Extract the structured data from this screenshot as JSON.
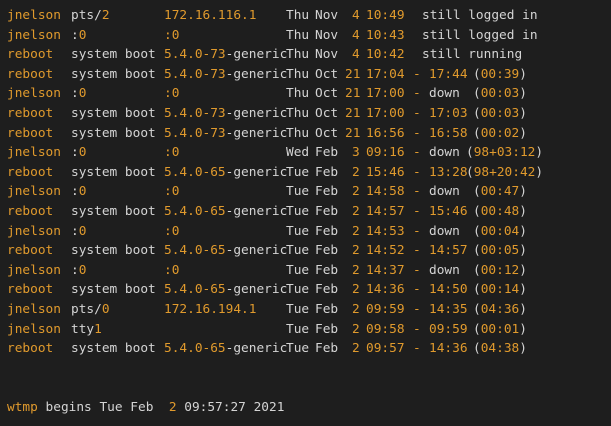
{
  "colors": {
    "background": "#1e1e1e",
    "text": "#d4d4d4",
    "accent": "#e09a2d"
  },
  "rows": [
    {
      "user": "jnelson",
      "tty": "pts/",
      "tty_num": "2",
      "host": "172.16.116.1",
      "day": "Thu",
      "mon": "Nov",
      "date": "4",
      "start": "10:49",
      "status": "still logged in",
      "end": "",
      "dur_open": "",
      "dur": "",
      "dur_close": ""
    },
    {
      "user": "jnelson",
      "tty": ":",
      "tty_num": "0",
      "host": ":0",
      "day": "Thu",
      "mon": "Nov",
      "date": "4",
      "start": "10:43",
      "status": "still logged in",
      "end": "",
      "dur_open": "",
      "dur": "",
      "dur_close": ""
    },
    {
      "user": "reboot",
      "tty": "system boot",
      "tty_num": "",
      "host": "5.4.0-73-generic",
      "day": "Thu",
      "mon": "Nov",
      "date": "4",
      "start": "10:42",
      "status": "still running",
      "end": "",
      "dur_open": "",
      "dur": "",
      "dur_close": ""
    },
    {
      "user": "reboot",
      "tty": "system boot",
      "tty_num": "",
      "host": "5.4.0-73-generic",
      "day": "Thu",
      "mon": "Oct",
      "date": "21",
      "start": "17:04",
      "status": "-",
      "end": "17:44",
      "dur_open": "(",
      "dur": "00:39",
      "dur_close": ")"
    },
    {
      "user": "jnelson",
      "tty": ":",
      "tty_num": "0",
      "host": ":0",
      "day": "Thu",
      "mon": "Oct",
      "date": "21",
      "start": "17:00",
      "status": "-",
      "end": "down",
      "dur_open": "(",
      "dur": "00:03",
      "dur_close": ")"
    },
    {
      "user": "reboot",
      "tty": "system boot",
      "tty_num": "",
      "host": "5.4.0-73-generic",
      "day": "Thu",
      "mon": "Oct",
      "date": "21",
      "start": "17:00",
      "status": "-",
      "end": "17:03",
      "dur_open": "(",
      "dur": "00:03",
      "dur_close": ")"
    },
    {
      "user": "reboot",
      "tty": "system boot",
      "tty_num": "",
      "host": "5.4.0-73-generic",
      "day": "Thu",
      "mon": "Oct",
      "date": "21",
      "start": "16:56",
      "status": "-",
      "end": "16:58",
      "dur_open": "(",
      "dur": "00:02",
      "dur_close": ")"
    },
    {
      "user": "jnelson",
      "tty": ":",
      "tty_num": "0",
      "host": ":0",
      "day": "Wed",
      "mon": "Feb",
      "date": "3",
      "start": "09:16",
      "status": "-",
      "end": "down",
      "dur_open": "(",
      "dur": "98+03:12",
      "dur_close": ")"
    },
    {
      "user": "reboot",
      "tty": "system boot",
      "tty_num": "",
      "host": "5.4.0-65-generic",
      "day": "Tue",
      "mon": "Feb",
      "date": "2",
      "start": "15:46",
      "status": "-",
      "end": "13:28",
      "dur_open": "(",
      "dur": "98+20:42",
      "dur_close": ")"
    },
    {
      "user": "jnelson",
      "tty": ":",
      "tty_num": "0",
      "host": ":0",
      "day": "Tue",
      "mon": "Feb",
      "date": "2",
      "start": "14:58",
      "status": "-",
      "end": "down",
      "dur_open": "(",
      "dur": "00:47",
      "dur_close": ")"
    },
    {
      "user": "reboot",
      "tty": "system boot",
      "tty_num": "",
      "host": "5.4.0-65-generic",
      "day": "Tue",
      "mon": "Feb",
      "date": "2",
      "start": "14:57",
      "status": "-",
      "end": "15:46",
      "dur_open": "(",
      "dur": "00:48",
      "dur_close": ")"
    },
    {
      "user": "jnelson",
      "tty": ":",
      "tty_num": "0",
      "host": ":0",
      "day": "Tue",
      "mon": "Feb",
      "date": "2",
      "start": "14:53",
      "status": "-",
      "end": "down",
      "dur_open": "(",
      "dur": "00:04",
      "dur_close": ")"
    },
    {
      "user": "reboot",
      "tty": "system boot",
      "tty_num": "",
      "host": "5.4.0-65-generic",
      "day": "Tue",
      "mon": "Feb",
      "date": "2",
      "start": "14:52",
      "status": "-",
      "end": "14:57",
      "dur_open": "(",
      "dur": "00:05",
      "dur_close": ")"
    },
    {
      "user": "jnelson",
      "tty": ":",
      "tty_num": "0",
      "host": ":0",
      "day": "Tue",
      "mon": "Feb",
      "date": "2",
      "start": "14:37",
      "status": "-",
      "end": "down",
      "dur_open": "(",
      "dur": "00:12",
      "dur_close": ")"
    },
    {
      "user": "reboot",
      "tty": "system boot",
      "tty_num": "",
      "host": "5.4.0-65-generic",
      "day": "Tue",
      "mon": "Feb",
      "date": "2",
      "start": "14:36",
      "status": "-",
      "end": "14:50",
      "dur_open": "(",
      "dur": "00:14",
      "dur_close": ")"
    },
    {
      "user": "jnelson",
      "tty": "pts/",
      "tty_num": "0",
      "host": "172.16.194.1",
      "day": "Tue",
      "mon": "Feb",
      "date": "2",
      "start": "09:59",
      "status": "-",
      "end": "14:35",
      "dur_open": "(",
      "dur": "04:36",
      "dur_close": ")"
    },
    {
      "user": "jnelson",
      "tty": "tty",
      "tty_num": "1",
      "host": "",
      "day": "Tue",
      "mon": "Feb",
      "date": "2",
      "start": "09:58",
      "status": "-",
      "end": "09:59",
      "dur_open": "(",
      "dur": "00:01",
      "dur_close": ")"
    },
    {
      "user": "reboot",
      "tty": "system boot",
      "tty_num": "",
      "host": "5.4.0-65-generic",
      "day": "Tue",
      "mon": "Feb",
      "date": "2",
      "start": "09:57",
      "status": "-",
      "end": "14:36",
      "dur_open": "(",
      "dur": "04:38",
      "dur_close": ")"
    }
  ],
  "footer": {
    "prefix": "wtmp",
    "middle": " begins Tue Feb  ",
    "date": "2",
    "time": " 09:57:27 2021"
  }
}
